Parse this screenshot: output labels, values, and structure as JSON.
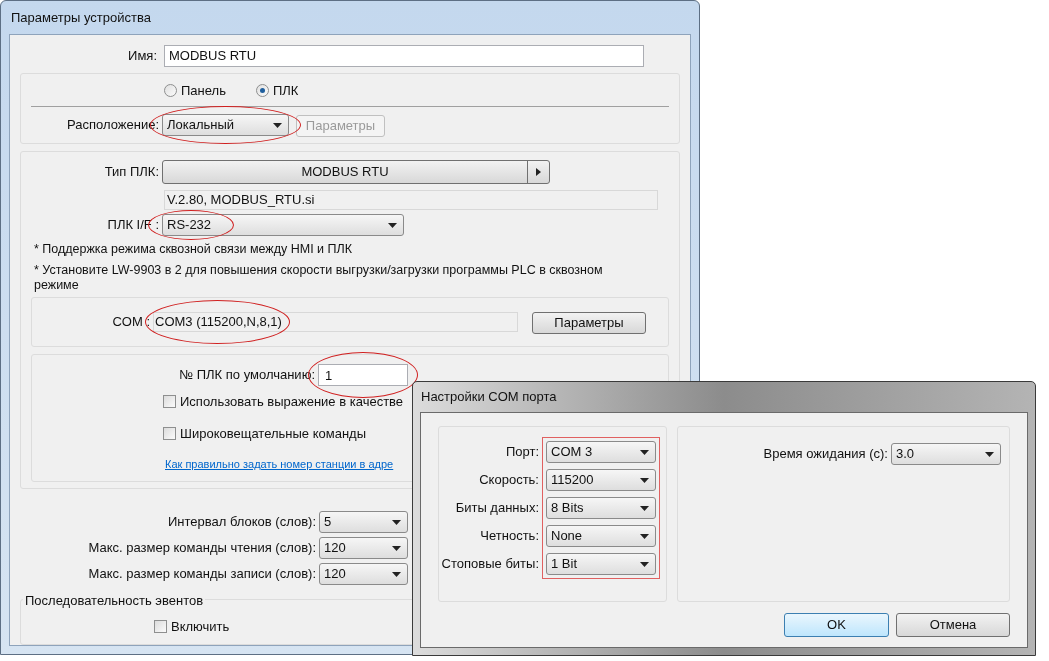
{
  "device_dialog": {
    "title": "Параметры устройства",
    "name": {
      "label": "Имя:",
      "value": "MODBUS RTU"
    },
    "mode_options": [
      {
        "label": "Панель",
        "selected": false
      },
      {
        "label": "ПЛК",
        "selected": true
      }
    ],
    "location": {
      "label": "Расположение:",
      "value": "Локальный",
      "highlighted": true
    },
    "location_params_button": {
      "label": "Параметры",
      "disabled": true
    },
    "plc_type": {
      "label": "Тип ПЛК:",
      "value": "MODBUS RTU"
    },
    "version": "V.2.80, MODBUS_RTU.si",
    "plc_if": {
      "label": "ПЛК I/F :",
      "value": "RS-232",
      "highlighted": true
    },
    "notes": [
      "* Поддержка режима сквозной связи между HMI и ПЛК",
      "* Установите LW-9903 в 2 для повышения скорости выгрузки/загрузки программы PLC в сквозном режиме"
    ],
    "com": {
      "label": "COM :",
      "value": "COM3 (115200,N,8,1)",
      "highlighted": true,
      "button": "Параметры"
    },
    "station": {
      "label": "№ ПЛК по умолчанию:",
      "value": "1",
      "highlighted": true
    },
    "checkboxes": [
      {
        "label": "Использовать выражение в качестве",
        "checked": false
      },
      {
        "label": "Широковещательные команды",
        "checked": false
      }
    ],
    "link": "Как правильно задать номер станции в адре",
    "block_settings": [
      {
        "label": "Интервал блоков (слов):",
        "value": "5"
      },
      {
        "label": "Макс. размер команды чтения (слов):",
        "value": "120"
      },
      {
        "label": "Макс. размер команды записи (слов):",
        "value": "120"
      }
    ],
    "event_group": {
      "title": "Последовательность эвентов",
      "checkbox": {
        "label": "Включить",
        "checked": false
      }
    }
  },
  "com_dialog": {
    "title": "Настройки COM порта",
    "fields_highlighted": true,
    "fields": [
      {
        "label": "Порт:",
        "value": "COM 3"
      },
      {
        "label": "Скорость:",
        "value": "115200"
      },
      {
        "label": "Биты данных:",
        "value": "8 Bits"
      },
      {
        "label": "Четность:",
        "value": "None"
      },
      {
        "label": "Стоповые биты:",
        "value": "1 Bit"
      }
    ],
    "timeout": {
      "label": "Время ожидания (с):",
      "value": "3.0"
    },
    "buttons": [
      {
        "label": "OK",
        "default": true
      },
      {
        "label": "Отмена",
        "default": false
      }
    ]
  }
}
